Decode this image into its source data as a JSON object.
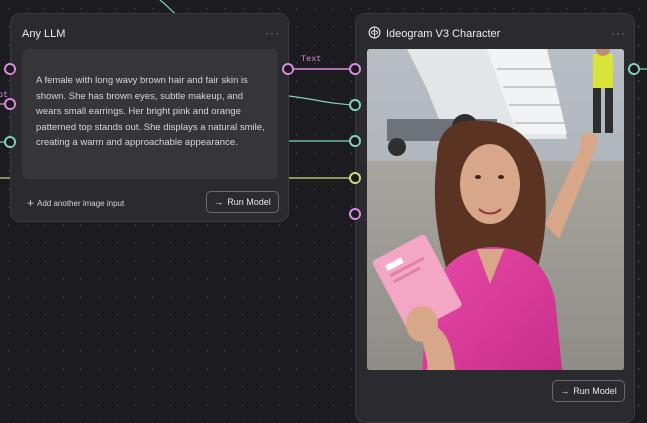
{
  "colors": {
    "canvas_bg": "#1c1b1f",
    "node_bg": "#2b2a2f",
    "wire_pink": "#d98ce0",
    "wire_teal": "#7fd4b8",
    "wire_green": "#c9e07a"
  },
  "llm_node": {
    "title": "Any LLM",
    "menu": "···",
    "output_text": "A female with long wavy brown hair and fair skin is shown. She has brown eyes, subtle makeup, and wears small earrings. Her bright pink and orange patterned top stands out. She displays a natural smile, creating a warm and approachable appearance.",
    "add_input_label": "Add another image input",
    "run_label": "Run Model"
  },
  "wires": {
    "text_label": "Text",
    "left_edge_label": "pt"
  },
  "ideogram_node": {
    "logo_icon": "ideogram-logo-icon",
    "title": "Ideogram V3 Character",
    "menu": "···",
    "run_label": "Run Model"
  }
}
